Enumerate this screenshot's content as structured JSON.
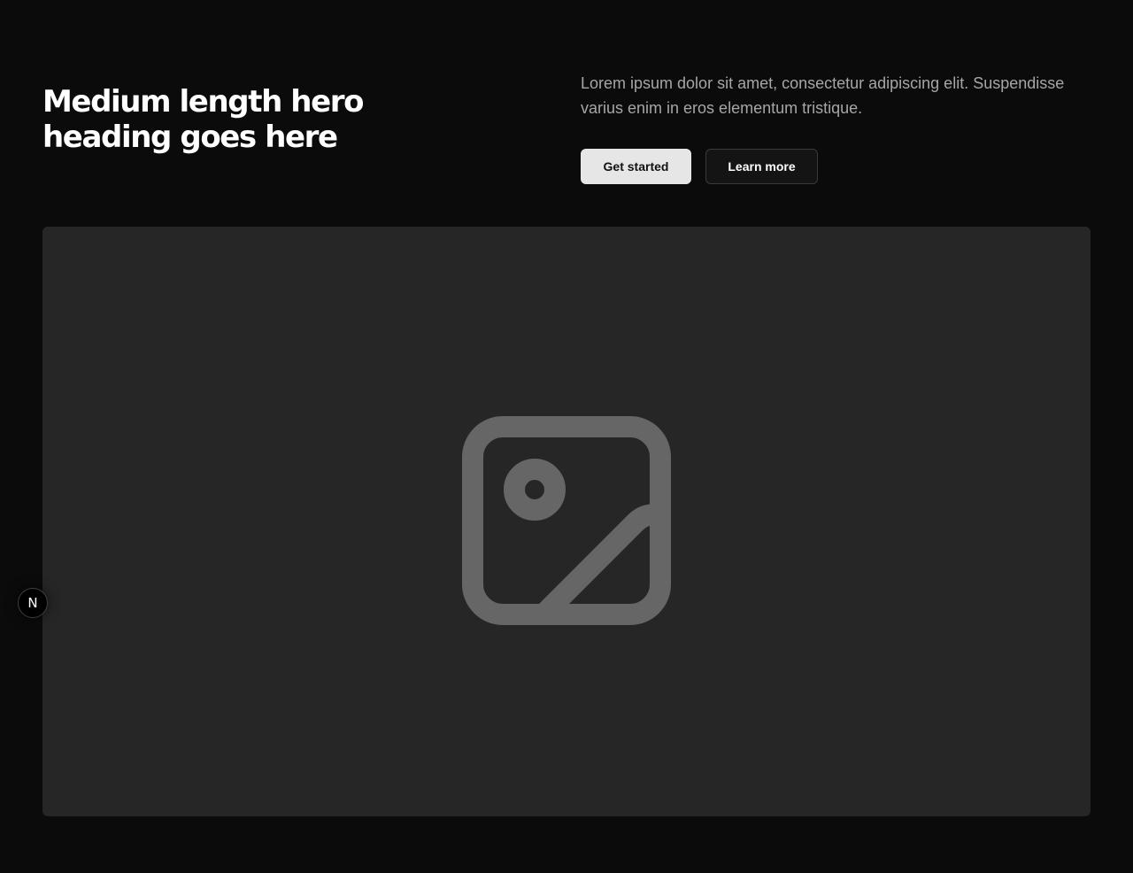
{
  "hero": {
    "heading": "Medium length hero heading goes here",
    "description": "Lorem ipsum dolor sit amet, consectetur adipiscing elit. Suspendisse varius enim in eros elementum tristique.",
    "primary_button": "Get started",
    "secondary_button": "Learn more"
  },
  "media": {
    "icon": "image-placeholder-icon"
  },
  "dev_badge": {
    "label": "N",
    "icon": "nextjs-logo-icon"
  },
  "colors": {
    "background": "#0b0b0b",
    "placeholder_bg": "#262626",
    "placeholder_icon": "#666666",
    "primary_button_bg": "#e6e6e6",
    "secondary_button_border": "#3a3a3a"
  }
}
